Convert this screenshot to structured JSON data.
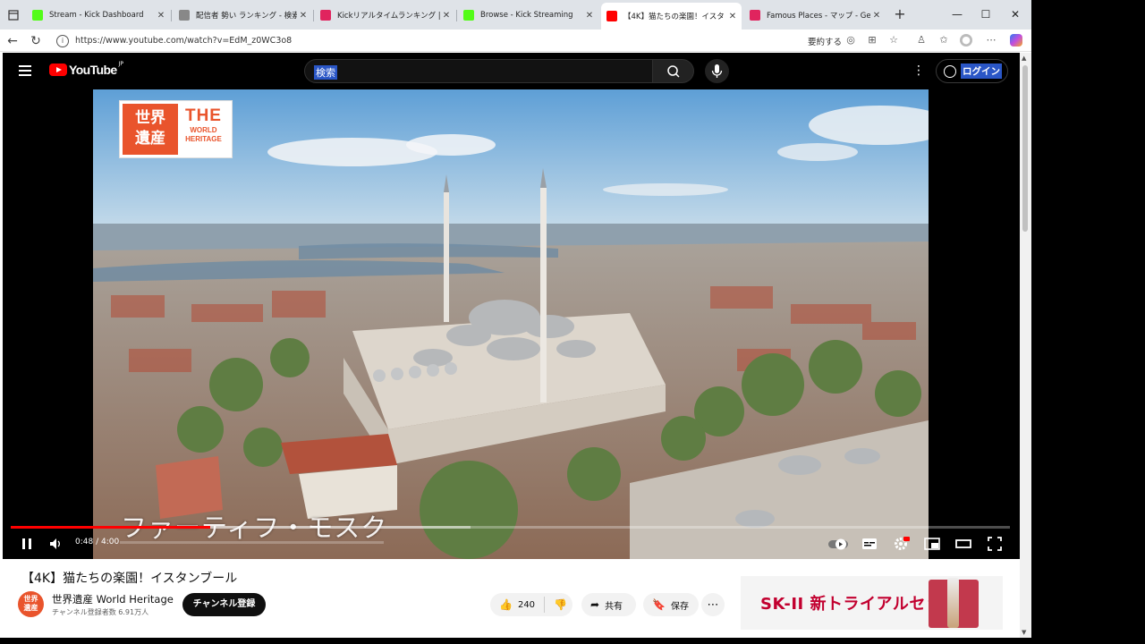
{
  "browser": {
    "tabs": [
      {
        "title": "Stream - Kick Dashboard",
        "favicon": "kick-icon",
        "color": "#53fc18",
        "active": false
      },
      {
        "title": "配信者 勢い ランキング - 検索",
        "favicon": "search-icon",
        "color": "#888888",
        "active": false
      },
      {
        "title": "Kickリアルタイムランキング | 配信",
        "favicon": "ranking-icon",
        "color": "#e0245e",
        "active": false
      },
      {
        "title": "Browse - Kick Streaming",
        "favicon": "kick-icon",
        "color": "#53fc18",
        "active": false
      },
      {
        "title": "【4K】猫たちの楽園！イスタ",
        "favicon": "youtube-icon",
        "color": "#ff0000",
        "active": true
      },
      {
        "title": "Famous Places - マップ - GeoG",
        "favicon": "map-pin-icon",
        "color": "#e0245e",
        "active": false
      }
    ],
    "url": "https://www.youtube.com/watch?v=EdM_z0WC3o8",
    "summary_label": "要約する"
  },
  "youtube": {
    "logo_text": "YouTube",
    "region": "JP",
    "search_placeholder": "検索",
    "login_label": "ログイン"
  },
  "video": {
    "badge_left": "世界\n遺産",
    "badge_the": "THE",
    "badge_sub1": "WORLD",
    "badge_sub2": "HERITAGE",
    "caption": "ファーティフ・モスク",
    "time_current": "0:48",
    "time_total": "4:00",
    "time_display": "0:48 / 4:00",
    "progress_played": 0.2,
    "progress_loaded": 0.46
  },
  "info": {
    "title": "【4K】猫たちの楽園！イスタンブール",
    "channel_name": "世界遺産 World Heritage",
    "channel_avatar": "世界\n遺産",
    "subscribers": "チャンネル登録者数 6.91万人",
    "subscribe_label": "チャンネル登録",
    "likes": "240",
    "share_label": "共有",
    "save_label": "保存"
  },
  "ad": {
    "brand": "SK-II",
    "text": "新トライアルセット"
  },
  "colors": {
    "youtube_red": "#ff0000",
    "heritage_orange": "#e9542c",
    "selection_blue": "#2a56c6"
  }
}
